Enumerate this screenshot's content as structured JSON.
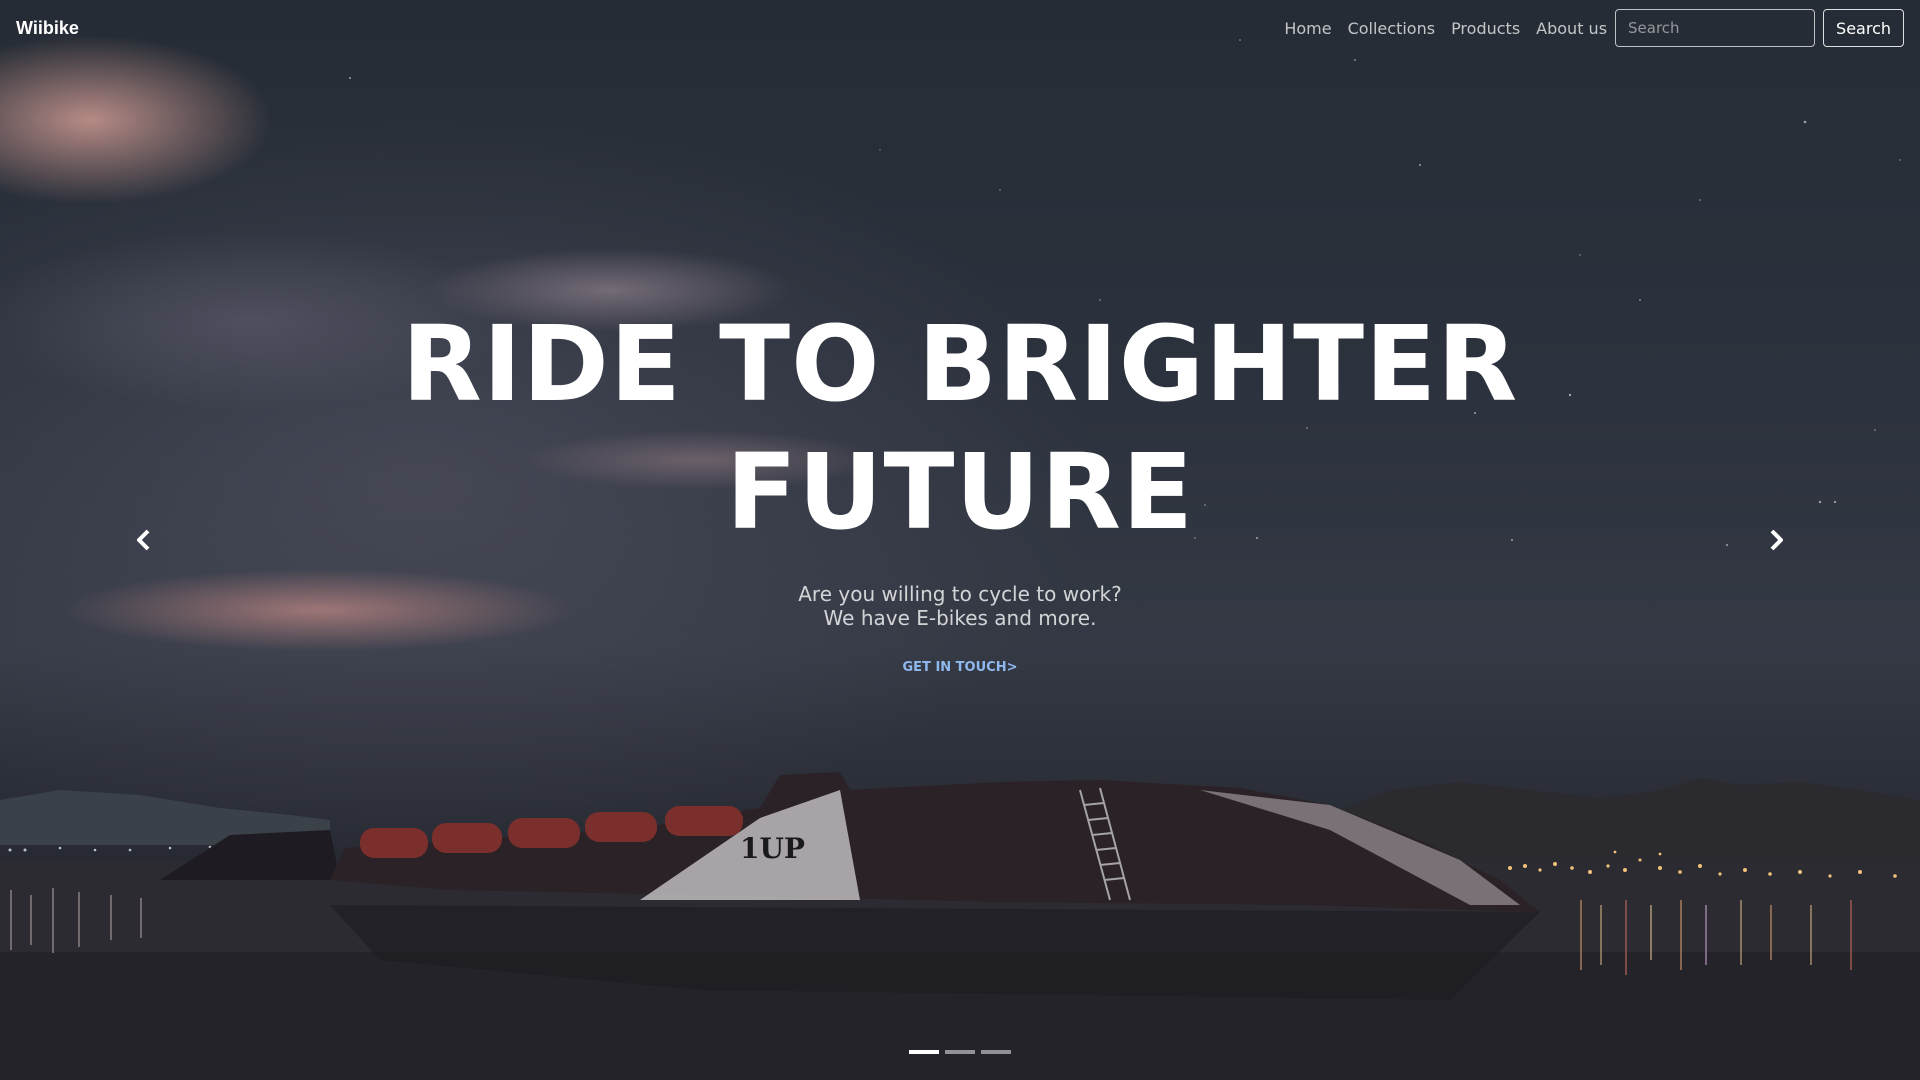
{
  "navbar": {
    "brand": "Wiibike",
    "links": [
      "Home",
      "Collections",
      "Products",
      "About us"
    ],
    "search_placeholder": "Search",
    "search_button": "Search"
  },
  "hero": {
    "headline_line1": "RIDE TO BRIGHTER",
    "headline_line2": "FUTURE",
    "subtitle_line1": "Are you willing to cycle to work?",
    "subtitle_line2": "We have E-bikes and more.",
    "cta_label": "GET IN TOUCH>",
    "boat_text": "1UP"
  },
  "carousel": {
    "prev_icon": "chevron-left-icon",
    "next_icon": "chevron-right-icon",
    "slide_count": 3,
    "active_slide": 1
  },
  "colors": {
    "cta": "#8fb8ee",
    "text": "#ffffff"
  }
}
